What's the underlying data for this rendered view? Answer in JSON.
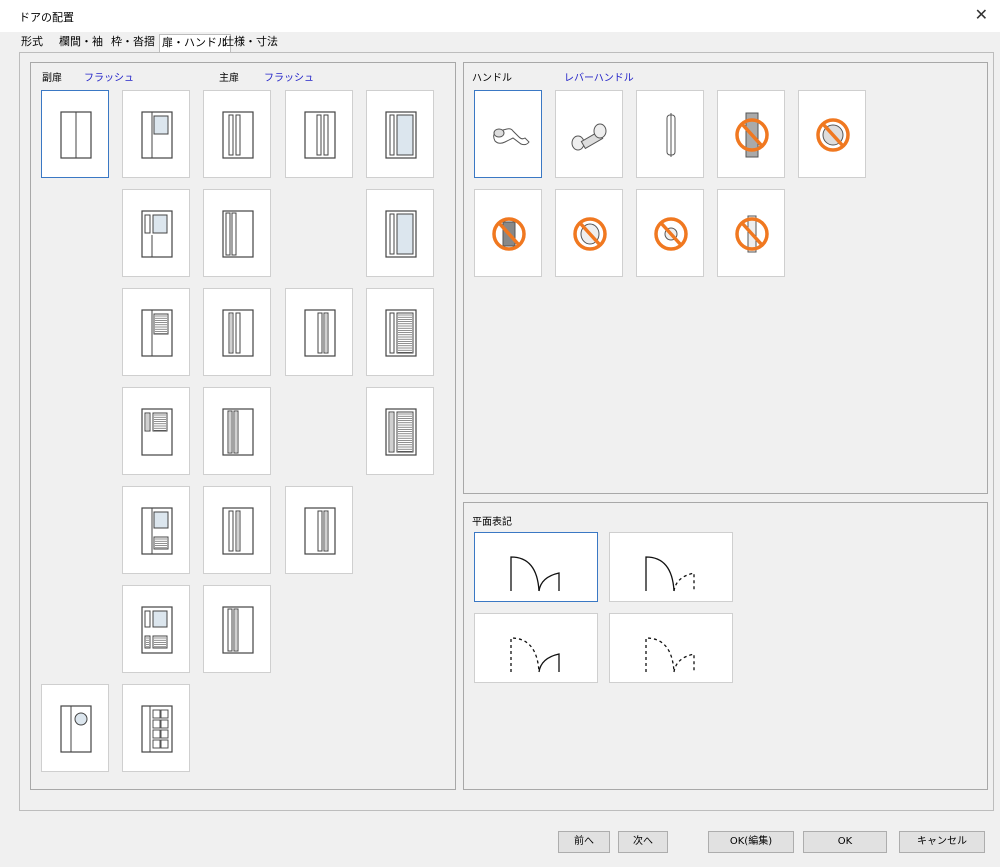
{
  "window": {
    "title": "ドアの配置"
  },
  "tabs": [
    "形式",
    "欄間・袖",
    "枠・沓摺",
    "扉・ハンドル",
    "仕様・寸法"
  ],
  "left_group": {
    "sub_label": "副扉",
    "sub_value": "フラッシュ",
    "main_label": "主扉",
    "main_value": "フラッシュ"
  },
  "handle_group": {
    "label": "ハンドル",
    "value": "レバーハンドル"
  },
  "plan_group": {
    "label": "平面表記"
  },
  "buttons": {
    "prev": "前へ",
    "next": "次へ",
    "ok_edit": "OK(編集)",
    "ok": "OK",
    "cancel": "キャンセル"
  },
  "colors": {
    "selected_border": "#3a78c4",
    "value_text": "#2323c8",
    "prohibit": "#f07820"
  }
}
